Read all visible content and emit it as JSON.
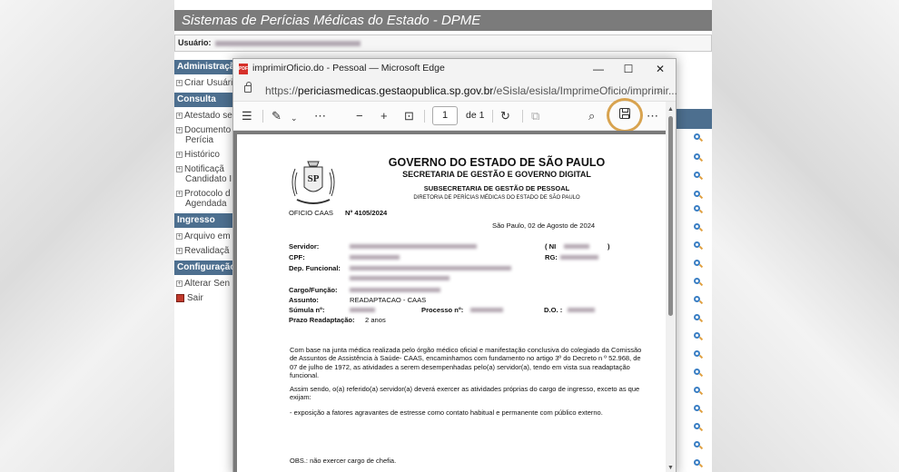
{
  "site": {
    "title": "Sistemas de Perícias Médicas do Estado - DPME",
    "user_label": "Usuário:",
    "menu": {
      "admin_header": "Administração",
      "admin_items": [
        "Criar Usuário"
      ],
      "consulta_header": "Consulta",
      "consulta_items": [
        "Atestado se",
        "Documento",
        "Perícia",
        "Histórico",
        "Notificaçã",
        "Candidato I",
        "Protocolo d",
        "Agendada"
      ],
      "ingresso_header": "Ingresso",
      "ingresso_items": [
        "Arquivo em",
        "Revalidaçã"
      ],
      "config_header": "Configuração",
      "config_items": [
        "Alterar Sen",
        "Sair"
      ]
    }
  },
  "browser": {
    "title": "imprimirOficio.do - Pessoal — Microsoft Edge",
    "url_prefix": "https://",
    "url_host": "periciasmedicas.gestaopublica.sp.gov.br",
    "url_path": "/eSisla/esisla/ImprimeOficio/imprimir...",
    "page_current": "1",
    "page_of": "de 1",
    "icons": [
      "contents-icon",
      "draw-icon",
      "more-icon",
      "zoom-out-icon",
      "zoom-in-icon",
      "fit-page-icon",
      "rotate-icon",
      "page-view-icon",
      "search-icon",
      "save-icon",
      "menu-more-icon"
    ]
  },
  "document": {
    "crest_text": "SP",
    "header1": "GOVERNO DO ESTADO DE SÃO PAULO",
    "header2": "SECRETARIA DE GESTÃO E GOVERNO DIGITAL",
    "header3": "SUBSECRETARIA DE GESTÃO DE PESSOAL",
    "header4": "DIRETORIA DE PERÍCIAS MÉDICAS DO ESTADO DE SÃO PAULO",
    "oficio_label": "OFICIO CAAS",
    "oficio_number": "Nº 4105/2024",
    "date": "São Paulo,  02 de Agosto de 2024",
    "labels": {
      "servidor": "Servidor:",
      "ni": "( NI",
      "ni_close": ")",
      "cpf": "CPF:",
      "rg": "RG:",
      "dep": "Dep. Funcional:",
      "cargo": "Cargo/Função:",
      "assunto": "Assunto:",
      "sumula": "Súmula nº:",
      "processo": "Processo nº:",
      "do": "D.O. :",
      "prazo": "Prazo Readaptação:"
    },
    "assunto_value": "READAPTACAO - CAAS",
    "prazo_value": "2 anos",
    "para1": "Com base na junta médica realizada pelo órgão médico oficial e manifestação conclusiva do colegiado da Comissão de Assuntos de Assistência à Saúde- CAAS, encaminhamos com fundamento no artigo 3º do Decreto n º 52.968, de 07 de julho de 1972, as atividades a serem desempenhadas pelo(a) servidor(a), tendo em vista sua readaptação funcional.",
    "para2": "Assim sendo, o(a) referido(a) servidor(a) deverá exercer as atividades próprias do cargo de ingresso, exceto as que exijam:",
    "para3": "- exposição a fatores agravantes de estresse como contato habitual e permanente com público externo.",
    "obs": "OBS.: não exercer cargo de chefia."
  }
}
